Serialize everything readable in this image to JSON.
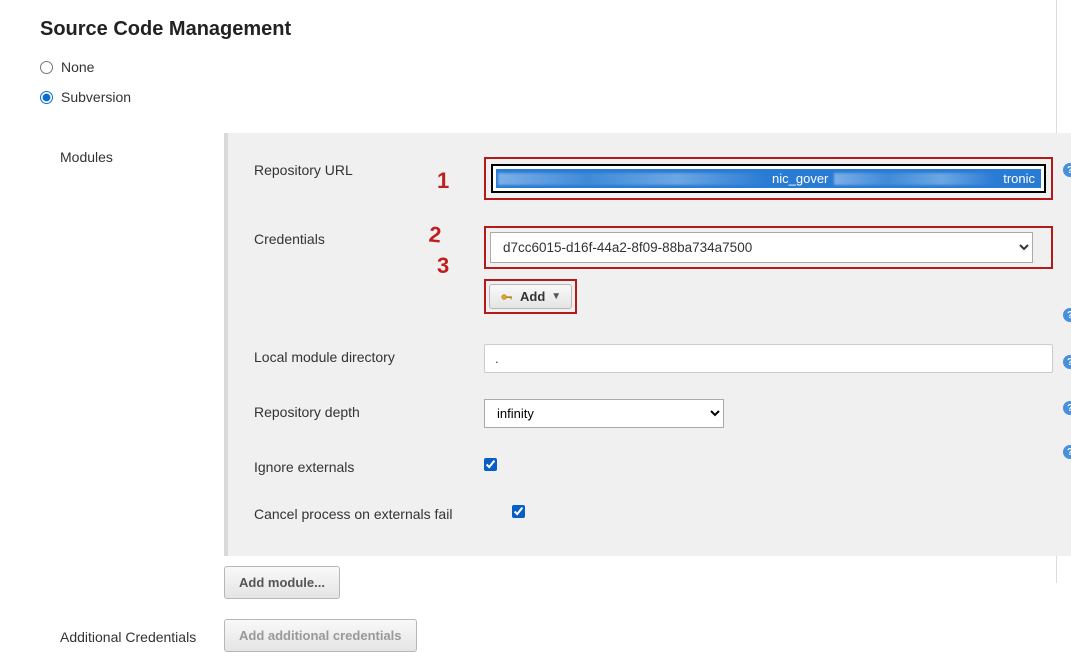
{
  "title": "Source Code Management",
  "radios": {
    "none": "None",
    "subversion": "Subversion",
    "selected": "subversion"
  },
  "modules": {
    "sectionLabel": "Modules",
    "repoUrl": {
      "label": "Repository URL",
      "valueSuffix": "tronic",
      "valueMidHint": "nic_gover"
    },
    "credentials": {
      "label": "Credentials",
      "selected": "d7cc6015-d16f-44a2-8f09-88ba734a7500"
    },
    "addBtnLabel": "Add",
    "localDir": {
      "label": "Local module directory",
      "value": "."
    },
    "depth": {
      "label": "Repository depth",
      "selected": "infinity"
    },
    "ignoreExternals": {
      "label": "Ignore externals",
      "checked": true
    },
    "cancelOnFail": {
      "label": "Cancel process on externals fail",
      "checked": true
    },
    "addModuleBtn": "Add module..."
  },
  "additionalCreds": {
    "sectionLabel": "Additional Credentials",
    "addBtn": "Add additional credentials"
  },
  "annotations": {
    "n1": "1",
    "n2": "2",
    "n3": "3"
  },
  "colors": {
    "annotationRed": "#b51a1a",
    "linkBlue": "#0b6dd4"
  }
}
